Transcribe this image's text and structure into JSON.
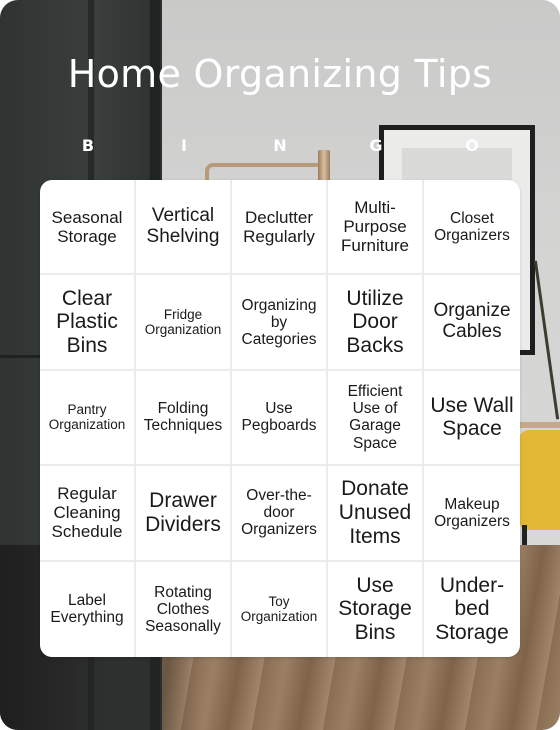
{
  "title": "Home Organizing Tips",
  "header_letters": [
    "B",
    "I",
    "N",
    "G",
    "O"
  ],
  "colors": {
    "title_text": "#ffffff",
    "card_bg": "#ffffff",
    "cell_border": "#ececec",
    "cell_text": "#1a1a1a"
  },
  "grid": [
    [
      "Seasonal Storage",
      "Vertical Shelving",
      "Declutter Regularly",
      "Multi-Purpose Furniture",
      "Closet Organizers"
    ],
    [
      "Clear Plastic Bins",
      "Fridge Organization",
      "Organizing by Categories",
      "Utilize Door Backs",
      "Organize Cables"
    ],
    [
      "Pantry Organization",
      "Folding Techniques",
      "Use Pegboards",
      "Efficient Use of Garage Space",
      "Use Wall Space"
    ],
    [
      "Regular Cleaning Schedule",
      "Drawer Dividers",
      "Over-the-door Organizers",
      "Donate Unused Items",
      "Makeup Organizers"
    ],
    [
      "Label Everything",
      "Rotating Clothes Seasonally",
      "Toy Organization",
      "Use Storage Bins",
      "Under-bed Storage"
    ]
  ]
}
